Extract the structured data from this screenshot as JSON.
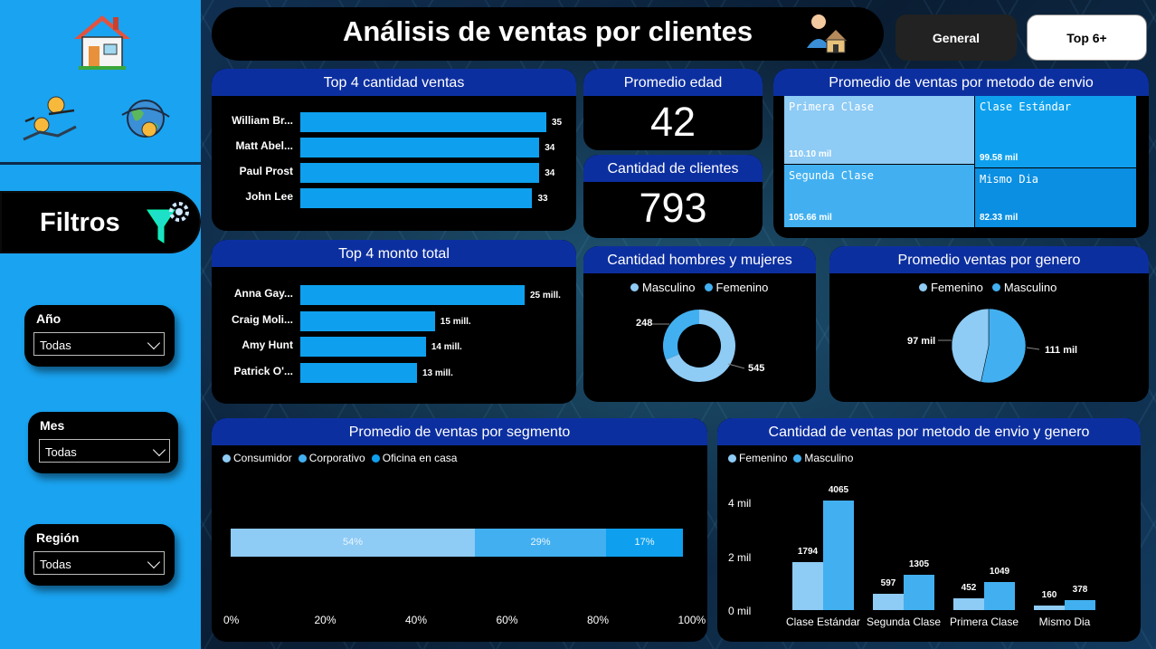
{
  "header": {
    "title": "Análisis de ventas por clientes"
  },
  "nav": {
    "general": "General",
    "top6": "Top 6+"
  },
  "sidebar": {
    "filtros_label": "Filtros",
    "filters": [
      {
        "label": "Año",
        "value": "Todas"
      },
      {
        "label": "Mes",
        "value": "Todas"
      },
      {
        "label": "Región",
        "value": "Todas"
      }
    ]
  },
  "kpis": {
    "edad": {
      "title": "Promedio edad",
      "value": "42"
    },
    "clientes": {
      "title": "Cantidad de clientes",
      "value": "793"
    }
  },
  "top_cantidad": {
    "title": "Top 4 cantidad ventas",
    "rows": [
      {
        "label": "William Br...",
        "value": "35"
      },
      {
        "label": "Matt Abel...",
        "value": "34"
      },
      {
        "label": "Paul Prost",
        "value": "34"
      },
      {
        "label": "John Lee",
        "value": "33"
      }
    ]
  },
  "top_monto": {
    "title": "Top 4 monto total",
    "rows": [
      {
        "label": "Anna Gay...",
        "value": "25 mill."
      },
      {
        "label": "Craig Moli...",
        "value": "15 mill."
      },
      {
        "label": "Amy Hunt",
        "value": "14 mill."
      },
      {
        "label": "Patrick O'...",
        "value": "13 mill."
      }
    ]
  },
  "envio_treemap": {
    "title": "Promedio de ventas por metodo de envio",
    "items": [
      {
        "name": "Primera Clase",
        "value": "110.10 mil"
      },
      {
        "name": "Clase Estándar",
        "value": "99.58 mil"
      },
      {
        "name": "Segunda Clase",
        "value": "105.66 mil"
      },
      {
        "name": "Mismo Dia",
        "value": "82.33 mil"
      }
    ]
  },
  "genero_donut": {
    "title": "Cantidad hombres y mujeres",
    "legend": [
      "Masculino",
      "Femenino"
    ],
    "labels": {
      "fem": "248",
      "masc": "545"
    }
  },
  "genero_pie": {
    "title": "Promedio ventas por genero",
    "legend": [
      "Femenino",
      "Masculino"
    ],
    "labels": {
      "fem": "97 mil",
      "masc": "111 mil"
    }
  },
  "segmento": {
    "title": "Promedio de ventas por segmento",
    "legend": [
      "Consumidor",
      "Corporativo",
      "Oficina en casa"
    ],
    "segments": [
      {
        "label": "54%"
      },
      {
        "label": "29%"
      },
      {
        "label": "17%"
      }
    ],
    "axis": [
      "0%",
      "20%",
      "40%",
      "60%",
      "80%",
      "100%"
    ]
  },
  "envio_genero": {
    "title": "Cantidad de ventas por metodo de envio y genero",
    "legend": [
      "Femenino",
      "Masculino"
    ],
    "yaxis": [
      "4 mil",
      "2 mil",
      "0 mil"
    ],
    "groups": [
      {
        "name": "Clase Estándar",
        "fem": "1794",
        "masc": "4065"
      },
      {
        "name": "Segunda Clase",
        "fem": "597",
        "masc": "1305"
      },
      {
        "name": "Primera Clase",
        "fem": "452",
        "masc": "1049"
      },
      {
        "name": "Mismo Dia",
        "fem": "160",
        "masc": "378"
      }
    ]
  },
  "colors": {
    "light": "#8ecbf5",
    "mid": "#42b0f0",
    "dark": "#0ea0ee",
    "header": "#0c2fa0"
  },
  "chart_data": [
    {
      "type": "bar",
      "title": "Top 4 cantidad ventas",
      "categories": [
        "William Br...",
        "Matt Abel...",
        "Paul Prost",
        "John Lee"
      ],
      "values": [
        35,
        34,
        34,
        33
      ]
    },
    {
      "type": "bar",
      "title": "Top 4 monto total",
      "categories": [
        "Anna Gay...",
        "Craig Moli...",
        "Amy Hunt",
        "Patrick O'..."
      ],
      "values": [
        25,
        15,
        14,
        13
      ]
    },
    {
      "type": "pie",
      "title": "Cantidad hombres y mujeres",
      "categories": [
        "Masculino",
        "Femenino"
      ],
      "values": [
        545,
        248
      ]
    },
    {
      "type": "pie",
      "title": "Promedio ventas por genero",
      "categories": [
        "Femenino",
        "Masculino"
      ],
      "values": [
        97,
        111
      ]
    },
    {
      "type": "bar",
      "title": "Promedio de ventas por segmento",
      "categories": [
        "Consumidor",
        "Corporativo",
        "Oficina en casa"
      ],
      "values": [
        54,
        29,
        17
      ]
    },
    {
      "type": "bar",
      "title": "Cantidad de ventas por metodo de envio y genero",
      "categories": [
        "Clase Estándar",
        "Segunda Clase",
        "Primera Clase",
        "Mismo Dia"
      ],
      "series": [
        {
          "name": "Femenino",
          "values": [
            1794,
            597,
            452,
            160
          ]
        },
        {
          "name": "Masculino",
          "values": [
            4065,
            1305,
            1049,
            378
          ]
        }
      ],
      "ylim": [
        0,
        4500
      ]
    }
  ]
}
